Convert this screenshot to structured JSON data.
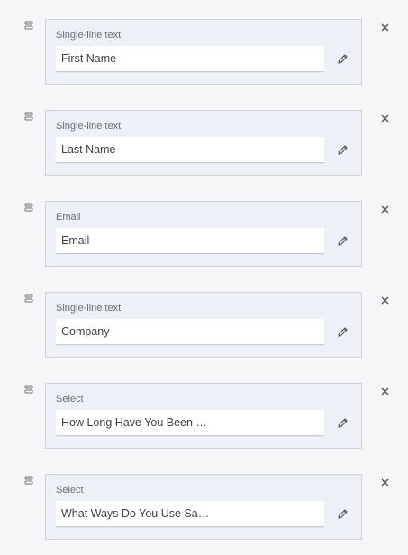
{
  "fields": [
    {
      "type": "Single-line text",
      "label": "First Name",
      "icons": {
        "drag": "drag-handle-icon",
        "edit": "pencil-icon",
        "remove": "close-icon"
      }
    },
    {
      "type": "Single-line text",
      "label": "Last Name",
      "icons": {
        "drag": "drag-handle-icon",
        "edit": "pencil-icon",
        "remove": "close-icon"
      }
    },
    {
      "type": "Email",
      "label": "Email",
      "icons": {
        "drag": "drag-handle-icon",
        "edit": "pencil-icon",
        "remove": "close-icon"
      }
    },
    {
      "type": "Single-line text",
      "label": "Company",
      "icons": {
        "drag": "drag-handle-icon",
        "edit": "pencil-icon",
        "remove": "close-icon"
      }
    },
    {
      "type": "Select",
      "label": "How Long Have You Been …",
      "icons": {
        "drag": "drag-handle-icon",
        "edit": "pencil-icon",
        "remove": "close-icon"
      }
    },
    {
      "type": "Select",
      "label": "What Ways Do You Use Sa…",
      "icons": {
        "drag": "drag-handle-icon",
        "edit": "pencil-icon",
        "remove": "close-icon"
      }
    }
  ],
  "colors": {
    "card_background": "#eef0f8",
    "card_border": "#cfd2da",
    "input_background": "#ffffff",
    "page_background": "#f6f6f8"
  }
}
